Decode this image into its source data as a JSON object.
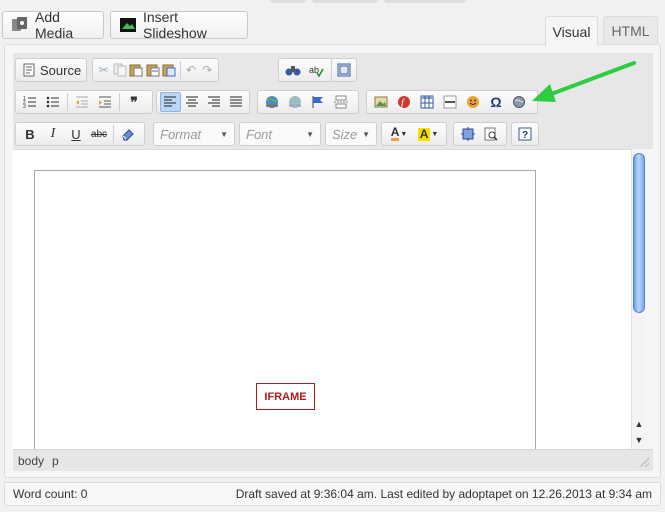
{
  "media_buttons": {
    "add_media": "Add Media",
    "insert_slideshow": "Insert Slideshow"
  },
  "tabs": {
    "visual": "Visual",
    "html": "HTML",
    "active": "Visual"
  },
  "toolbar": {
    "source_label": "Source",
    "format_placeholder": "Format",
    "font_placeholder": "Font",
    "size_placeholder": "Size",
    "align_left_active": true
  },
  "content": {
    "iframe_label": "IFRAME"
  },
  "pathbar": {
    "items": [
      "body",
      "p"
    ]
  },
  "status": {
    "word_count": "Word count: 0",
    "draft_saved": "Draft saved at 9:36:04 am. Last edited by adoptapet on 12.26.2013 at 9:34 am"
  },
  "annotation": {
    "arrow_color": "#2ecc40"
  }
}
